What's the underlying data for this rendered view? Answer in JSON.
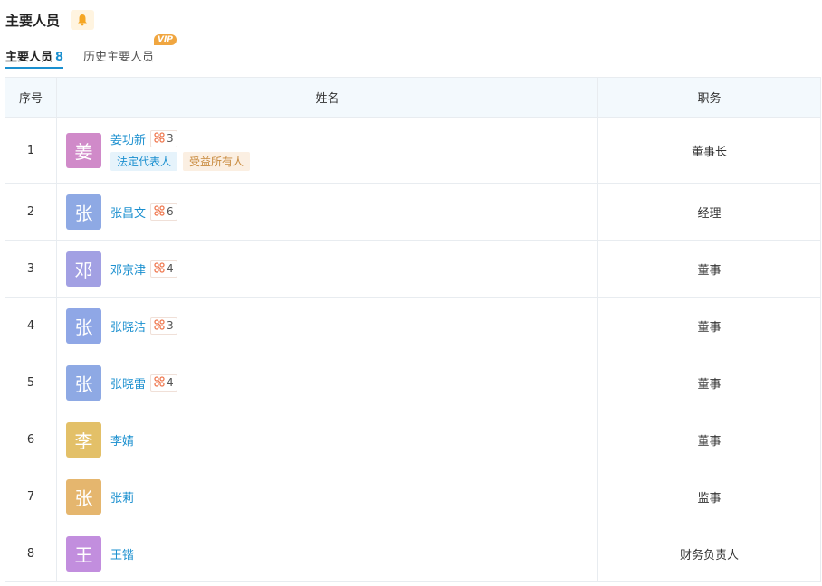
{
  "header": {
    "title": "主要人员"
  },
  "tabs": [
    {
      "label": "主要人员",
      "count": "8"
    },
    {
      "label": "历史主要人员",
      "badge": "VIP"
    }
  ],
  "table": {
    "headers": [
      "序号",
      "姓名",
      "职务"
    ],
    "rows": [
      {
        "idx": "1",
        "avatar": "姜",
        "avatar_color": "#d08ac9",
        "name": "姜功新",
        "rel": "3",
        "role": "董事长",
        "tags": [
          "法定代表人",
          "受益所有人"
        ]
      },
      {
        "idx": "2",
        "avatar": "张",
        "avatar_color": "#8ea9e4",
        "name": "张昌文",
        "rel": "6",
        "role": "经理"
      },
      {
        "idx": "3",
        "avatar": "邓",
        "avatar_color": "#a2a0e3",
        "name": "邓京津",
        "rel": "4",
        "role": "董事"
      },
      {
        "idx": "4",
        "avatar": "张",
        "avatar_color": "#8fa7e6",
        "name": "张晓洁",
        "rel": "3",
        "role": "董事"
      },
      {
        "idx": "5",
        "avatar": "张",
        "avatar_color": "#8ea9e4",
        "name": "张晓雷",
        "rel": "4",
        "role": "董事"
      },
      {
        "idx": "6",
        "avatar": "李",
        "avatar_color": "#e3c068",
        "name": "李婧",
        "role": "董事"
      },
      {
        "idx": "7",
        "avatar": "张",
        "avatar_color": "#e5b66e",
        "name": "张莉",
        "role": "监事"
      },
      {
        "idx": "8",
        "avatar": "王",
        "avatar_color": "#c28ede",
        "name": "王锴",
        "role": "财务负责人"
      }
    ]
  }
}
